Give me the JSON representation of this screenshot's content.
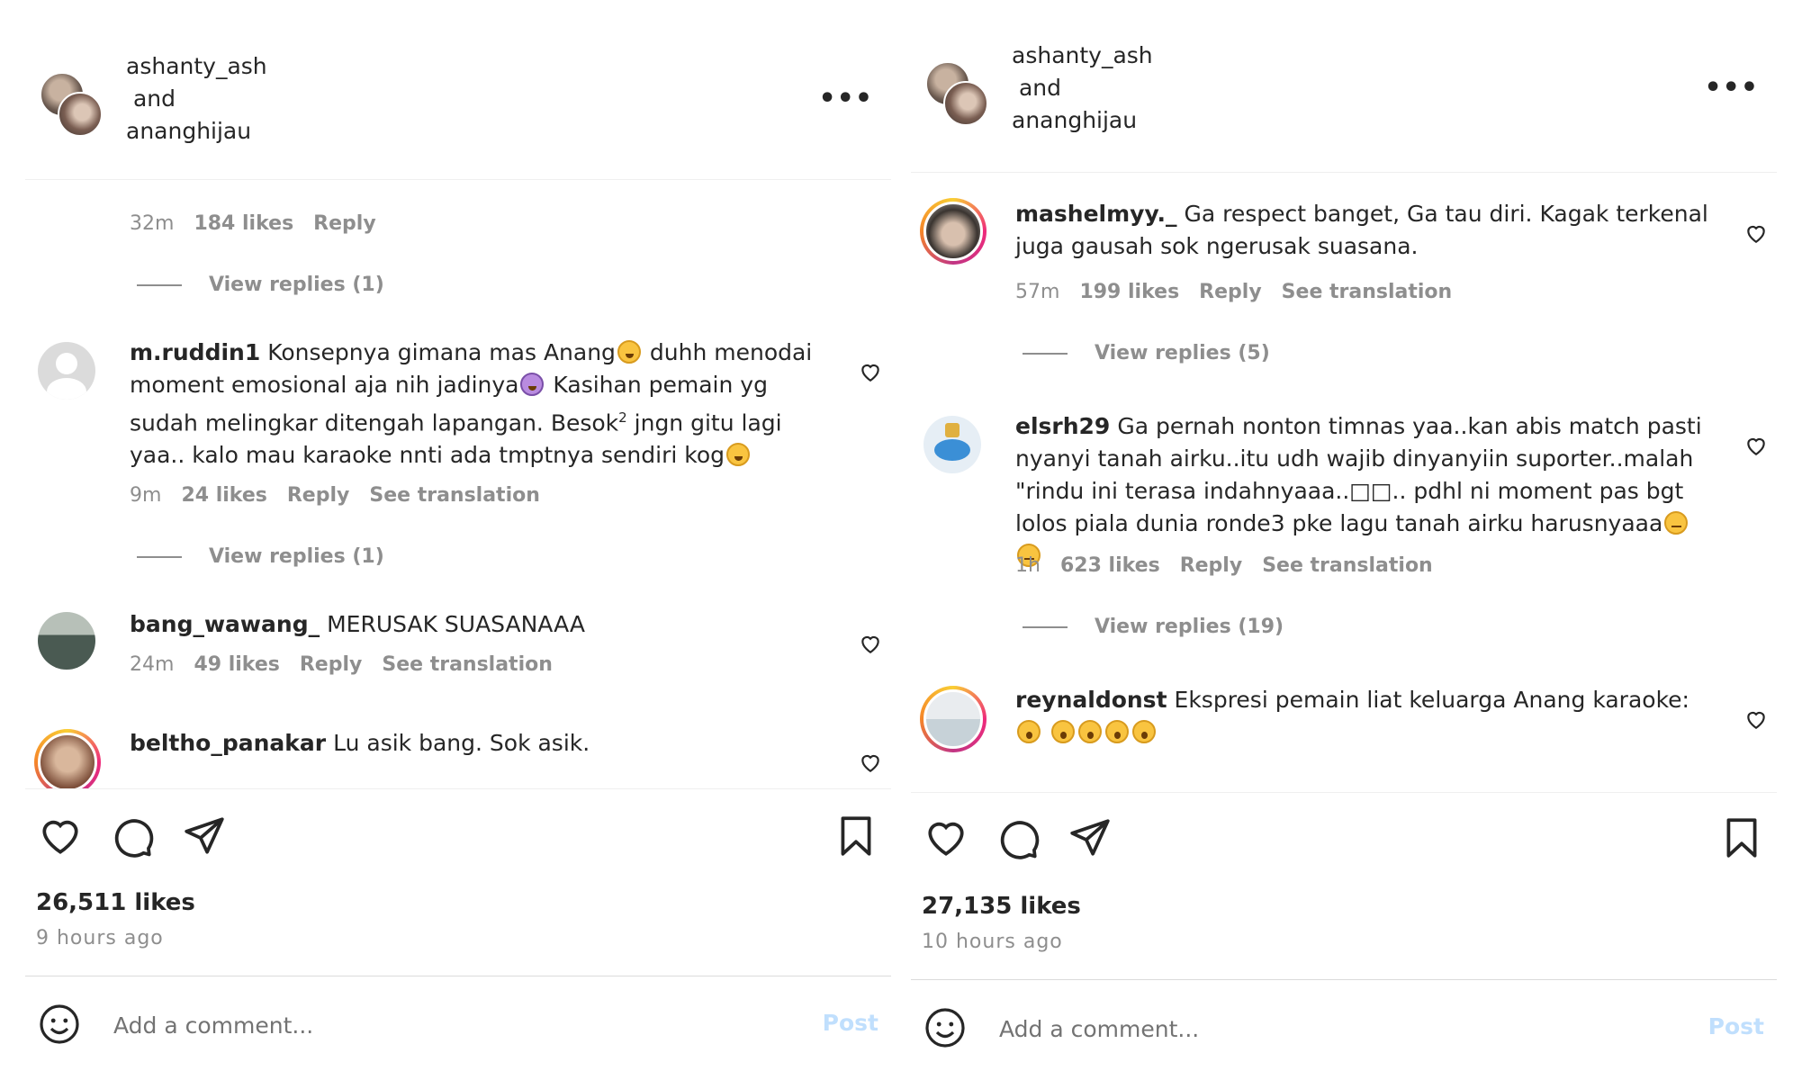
{
  "left": {
    "header": {
      "name1": "ashanty_ash",
      "and": " and",
      "name2": "ananghijau"
    },
    "partial_comment": {
      "time": "32m",
      "likes": "184 likes",
      "reply": "Reply",
      "view_replies": "View replies (1)"
    },
    "comments": [
      {
        "user": "m.ruddin1",
        "text_parts": [
          "Konsepnya gimana mas Anang",
          " duhh menodai moment emosional aja nih jadinya",
          " Kasihan pemain yg sudah melingkar ditengah lapangan. Besok",
          "2",
          " jngn gitu lagi yaa.. kalo mau karaoke nnti ada tmptnya sendiri kog"
        ],
        "time": "9m",
        "likes": "24 likes",
        "reply": "Reply",
        "translation": "See translation",
        "view_replies": "View replies (1)"
      },
      {
        "user": "bang_wawang_",
        "text": "MERUSAK SUASANAAA",
        "time": "24m",
        "likes": "49 likes",
        "reply": "Reply",
        "translation": "See translation"
      },
      {
        "user": "beltho_panakar",
        "text": "Lu asik bang. Sok asik."
      }
    ],
    "likes_count": "26,511 likes",
    "time_ago": "9 hours ago",
    "add_comment_placeholder": "Add a comment...",
    "post_label": "Post"
  },
  "right": {
    "header": {
      "name1": "ashanty_ash",
      "and": " and",
      "name2": "ananghijau"
    },
    "comments": [
      {
        "user": "mashelmyy._",
        "text": "Ga respect banget, Ga tau diri. Kagak terkenal juga gausah sok ngerusak suasana.",
        "time": "57m",
        "likes": "199 likes",
        "reply": "Reply",
        "translation": "See translation",
        "view_replies": "View replies (5)"
      },
      {
        "user": "elsrh29",
        "text": "Ga pernah nonton timnas yaa..kan abis match pasti nyanyi tanah airku..itu udh wajib dinyanyiin suporter..malah \"rindu ini terasa indahnyaaa..□□.. pdhl ni moment pas bgt lolos piala dunia ronde3 pke lagu tanah airku harusnyaaa",
        "time": "1h",
        "likes": "623 likes",
        "reply": "Reply",
        "translation": "See translation",
        "view_replies": "View replies (19)"
      },
      {
        "user": "reynaldonst",
        "text": "Ekspresi pemain liat keluarga Anang karaoke:"
      }
    ],
    "likes_count": "27,135 likes",
    "time_ago": "10 hours ago",
    "add_comment_placeholder": "Add a comment...",
    "post_label": "Post"
  },
  "colors": {
    "text": "#262626",
    "muted": "#8e8e8e",
    "post_disabled": "#c0dffd",
    "divider": "#efefef"
  }
}
